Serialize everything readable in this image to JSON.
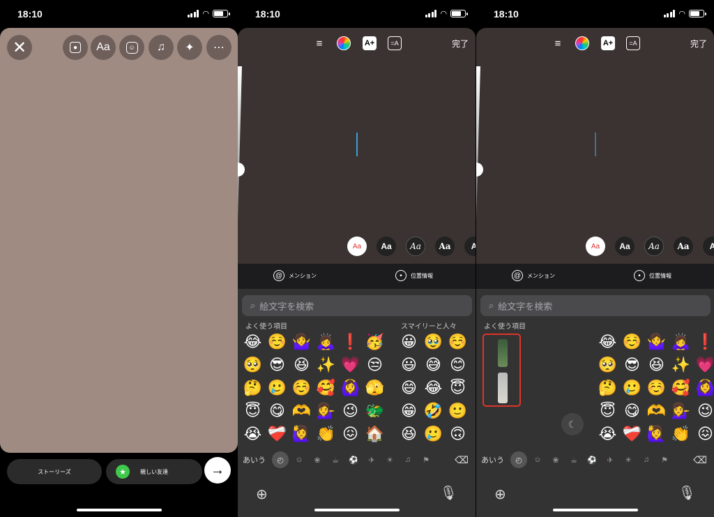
{
  "status": {
    "time": "18:10"
  },
  "panel1": {
    "toolbar_icons": [
      "close-icon",
      "person-frame-icon",
      "text-icon",
      "sticker-icon",
      "music-note-icon",
      "sparkles-icon",
      "more-icon"
    ],
    "text_tool_label": "Aa",
    "bottom": {
      "stories_label": "ストーリーズ",
      "close_friends_label": "親しい友達"
    },
    "canvas_color": "#a08b83"
  },
  "editor": {
    "done_label": "完了",
    "aplus_label": "A+",
    "anim_label": "=A",
    "fonts": [
      "Aa",
      "Aa",
      "Aa",
      "Aa",
      "A"
    ],
    "mention_label": "メンション",
    "location_label": "位置情報",
    "search_placeholder": "絵文字を検索",
    "frequent_label": "よく使う項目",
    "smileys_label": "スマイリーと人々",
    "kana_label": "あいう",
    "accent_color": "#3a9fd6",
    "sticker_highlight_color": "#e0342b"
  },
  "emoji": {
    "frequent": [
      "😂",
      "☺️",
      "🤷‍♀️",
      "🙇‍♀️",
      "❗",
      "🥳",
      "🥺",
      "😎",
      "😆",
      "✨",
      "💗",
      "😒",
      "🤔",
      "🥲",
      "☺️",
      "🥰",
      "🙆‍♀️",
      "🫣",
      "😇",
      "😋",
      "🫶",
      "💁‍♀️",
      "😉",
      "🐲",
      "😭",
      "❤️‍🩹",
      "🙋‍♀️",
      "👏",
      "😖",
      "🏠"
    ],
    "smileys": [
      "😀",
      "🥹",
      "☺️",
      "😃",
      "😅",
      "😊",
      "😄",
      "😂",
      "😇",
      "😁",
      "🤣",
      "🙂",
      "😆",
      "🥲",
      "🙃"
    ],
    "frequent_p3": [
      "😂",
      "☺️",
      "🤷‍♀️",
      "🙇‍♀️",
      "❗",
      "🥺",
      "😎",
      "😆",
      "✨",
      "💗",
      "🤔",
      "🥲",
      "☺️",
      "🥰",
      "🙆‍♀️",
      "😇",
      "😋",
      "🫶",
      "💁‍♀️",
      "😉",
      "😭",
      "❤️‍🩹",
      "🙋‍♀️",
      "👏",
      "😖"
    ]
  }
}
